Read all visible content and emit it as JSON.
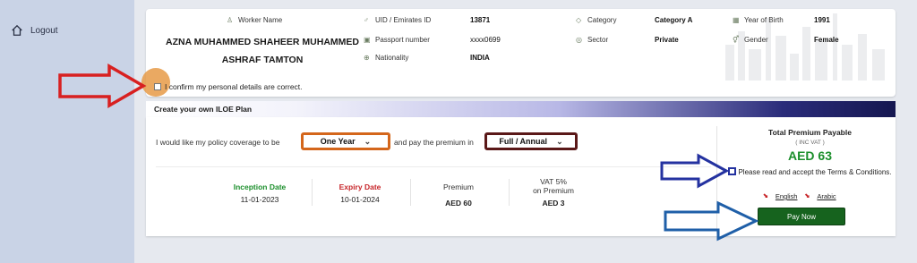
{
  "sidebar": {
    "logout_label": "Logout"
  },
  "worker": {
    "name_label": "Worker Name",
    "name": "AZNA MUHAMMED SHAHEER MUHAMMED ASHRAF TAMTON",
    "uid_label": "UID / Emirates ID",
    "uid": "13871",
    "passport_label": "Passport number",
    "passport": "xxxx0699",
    "nationality_label": "Nationality",
    "nationality": "INDIA",
    "category_label": "Category",
    "category": "Category A",
    "sector_label": "Sector",
    "sector": "Private",
    "yob_label": "Year of Birth",
    "yob": "1991",
    "gender_label": "Gender",
    "gender": "Female"
  },
  "confirm_text": "I confirm my personal details are correct.",
  "plan": {
    "title": "Create your own ILOE Plan",
    "policy_text": "I would like my policy coverage to be",
    "pay_text": "and pay the premium in",
    "coverage_selected": "One Year",
    "payment_selected": "Full / Annual",
    "inception_label": "Inception Date",
    "inception_date": "11-01-2023",
    "expiry_label": "Expiry Date",
    "expiry_date": "10-01-2024",
    "premium_label": "Premium",
    "premium": "AED 60",
    "vat_label_1": "VAT 5%",
    "vat_label_2": "on Premium",
    "vat": "AED 3"
  },
  "total": {
    "title": "Total Premium Payable",
    "sub": "( INC VAT )",
    "amount": "AED 63",
    "terms": "Please read and accept the Terms & Conditions.",
    "english": "English",
    "arabic": "Arabic",
    "pay_label": "Pay Now"
  },
  "colors": {
    "accent_green": "#1c8f2c",
    "pay_button": "#16631e",
    "arrow_red": "#d82020",
    "arrow_blue": "#2432a0",
    "highlight_orange": "#d4661b"
  }
}
